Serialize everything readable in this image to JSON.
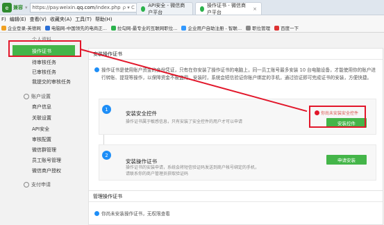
{
  "browser": {
    "badge": "e",
    "mode_label": "兼容",
    "url_prefix": "https://pay.weixin.",
    "url_host": "qq.com",
    "url_suffix": "/index.php",
    "url_icons": "ρ ▾ C",
    "tabs": [
      {
        "label": "API安全 - 微信商户平台"
      },
      {
        "label": "操作证书 - 微信商户平台"
      }
    ],
    "close_glyph": "×"
  },
  "menubar": {
    "items": [
      "F)",
      "编辑(E)",
      "查看(V)",
      "收藏夹(A)",
      "工具(T)",
      "帮助(H)"
    ]
  },
  "favorites": {
    "items": [
      "企业登录-英德网",
      "电脑网-中国领先的电商正...",
      "拉勾网-最专业的互联网职位...",
      "企业用户自助注册 - 智联...",
      "职位管理",
      "百度一下"
    ]
  },
  "sidebar": {
    "top_item": "个人资料",
    "active_item": "操作证书",
    "items": [
      "待审核任务",
      "已审核任务",
      "我提交的审核任务"
    ],
    "group_account": "账户设置",
    "account_items": [
      "商户信息",
      "关联设置",
      "API安全",
      "审核配置",
      "微信群管理",
      "员工账号管理",
      "微信商户授权"
    ],
    "group_pay": "支付申请"
  },
  "main": {
    "panel1_title": "安装操作证书",
    "notice": "操作证书是使用账户资金的身份凭证，只有在你安装了操作证书的电脑上，同一员工账号最多安装 10 台电脑设备，才能使用你的账户进行转账、提现等操作，以保障资金不被盗用。安装时，系统会短信验证你账户绑定的手机，通过验证即可完成证书的安装，方便快捷。",
    "step1": {
      "num": "1",
      "title": "安装安全控件",
      "desc": "操作证书属于敏感信息，只有安装了安全控件的用户才可以申请",
      "warn": "你尚未安装安全控件",
      "button": "安装控件"
    },
    "step2": {
      "num": "2",
      "title": "安装操作证书",
      "desc_line1": "操作证书的安装申请，系统会将短信验证码发送到商户帐号绑定的手机，",
      "desc_line2": "请联系你的商户管理员获取验证码",
      "button": "申请安装"
    },
    "panel2_title": "管理操作证书",
    "panel2_notice": "你尚未安装操作证书，无权限查看"
  },
  "colors": {
    "accent_green": "#44b549",
    "highlight_red": "#e2162a",
    "info_blue": "#1e8ef7"
  }
}
